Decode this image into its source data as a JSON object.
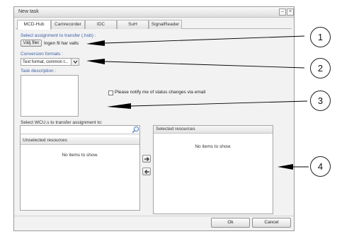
{
  "window": {
    "title": "New task",
    "minimize_glyph": "–",
    "close_glyph": "×"
  },
  "tabs": [
    {
      "label": "MCD-Hub",
      "active": true
    },
    {
      "label": "Camrecorder",
      "active": false
    },
    {
      "label": "IDC",
      "active": false
    },
    {
      "label": "SuH",
      "active": false
    },
    {
      "label": "SignalReader",
      "active": false
    }
  ],
  "assignment": {
    "label": "Select assignment to transfer (.hub) :",
    "choose_button": "Välj filer",
    "no_file_text": "Ingen fil har valts"
  },
  "conversion": {
    "label": "Conversion formats :",
    "selected": "Text format, common t..."
  },
  "task_description": {
    "label": "Task description :",
    "value": ""
  },
  "notify": {
    "label": "Please notify me of status changes via email",
    "checked": false
  },
  "wcu": {
    "label": "Select WCU.s to transfer assignment to:",
    "search_value": "",
    "unselected_header": "Unselected resources",
    "unselected_empty": "No items to show.",
    "selected_header": "Selected resources",
    "selected_empty": "No items to show."
  },
  "footer": {
    "ok_label": "Ok",
    "cancel_label": "Cancel"
  },
  "callouts": [
    "1",
    "2",
    "3",
    "4"
  ],
  "icons": {
    "magnifier": "search-icon",
    "move_right": "arrow-right-icon",
    "move_left": "arrow-left-icon",
    "dropdown": "chevron-down-icon"
  }
}
